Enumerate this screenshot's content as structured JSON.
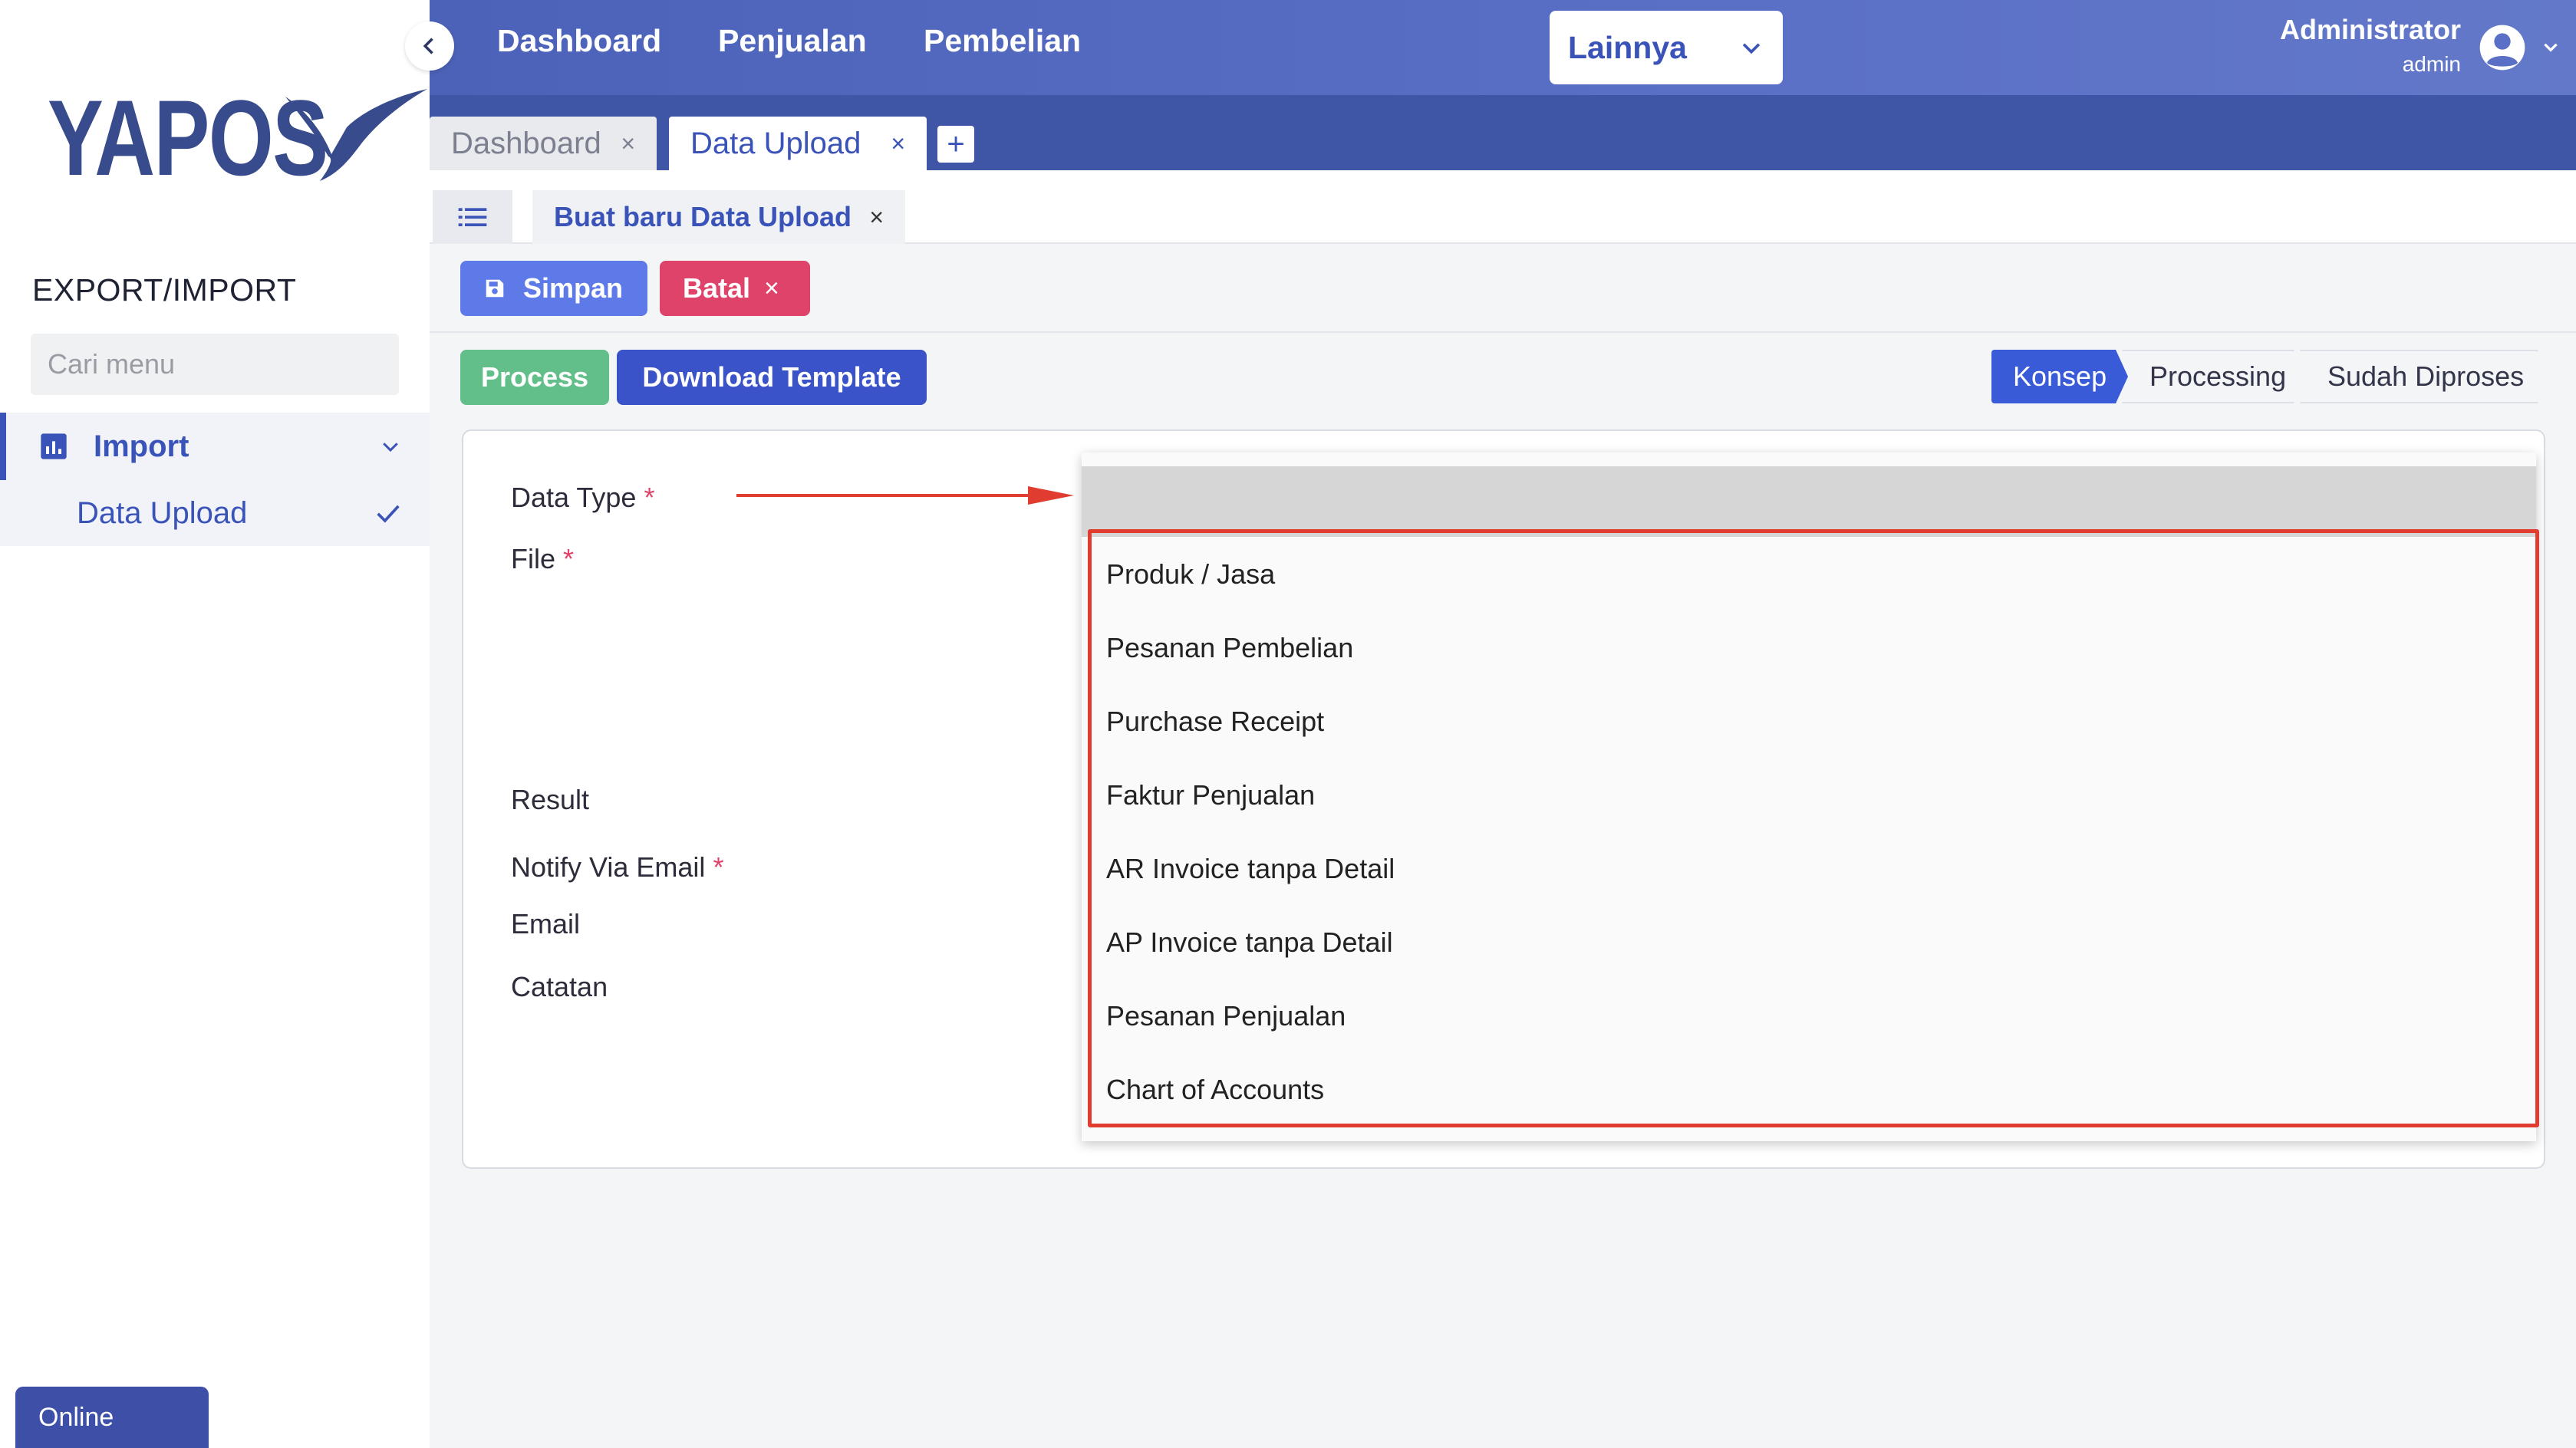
{
  "sidebar": {
    "logo_text": "YAPOS",
    "section_title": "EXPORT/IMPORT",
    "search_placeholder": "Cari menu",
    "menu": {
      "parent_label": "Import",
      "child_label": "Data Upload"
    },
    "status": "Online"
  },
  "topbar": {
    "nav": [
      "Dashboard",
      "Penjualan",
      "Pembelian"
    ],
    "more_label": "Lainnya",
    "user_name": "Administrator",
    "user_role": "admin"
  },
  "tabs": {
    "items": [
      {
        "label": "Dashboard",
        "close": "×"
      },
      {
        "label": "Data Upload",
        "close": "×"
      }
    ],
    "add": "+"
  },
  "subtab": {
    "label": "Buat baru Data Upload",
    "close": "×"
  },
  "actions": {
    "save_label": "Simpan",
    "cancel_label": "Batal",
    "cancel_icon": "×",
    "process_label": "Process",
    "download_label": "Download Template"
  },
  "status_steps": [
    "Konsep",
    "Processing",
    "Sudah Diproses"
  ],
  "form": {
    "labels": {
      "data_type": "Data Type",
      "file": "File",
      "result": "Result",
      "notify": "Notify Via Email",
      "email": "Email",
      "notes": "Catatan"
    },
    "required_mark": "*"
  },
  "dropdown": {
    "options": [
      "Produk / Jasa",
      "Pesanan Pembelian",
      "Purchase Receipt",
      "Faktur Penjualan",
      "AR Invoice tanpa Detail",
      "AP Invoice tanpa Detail",
      "Pesanan Penjualan",
      "Chart of Accounts"
    ]
  },
  "colors": {
    "brand": "#3a53b8",
    "save": "#5d7ae8",
    "cancel": "#e0436a",
    "process": "#63bf8a",
    "download": "#3a53c8",
    "highlight_annotation": "#e03c2f"
  }
}
